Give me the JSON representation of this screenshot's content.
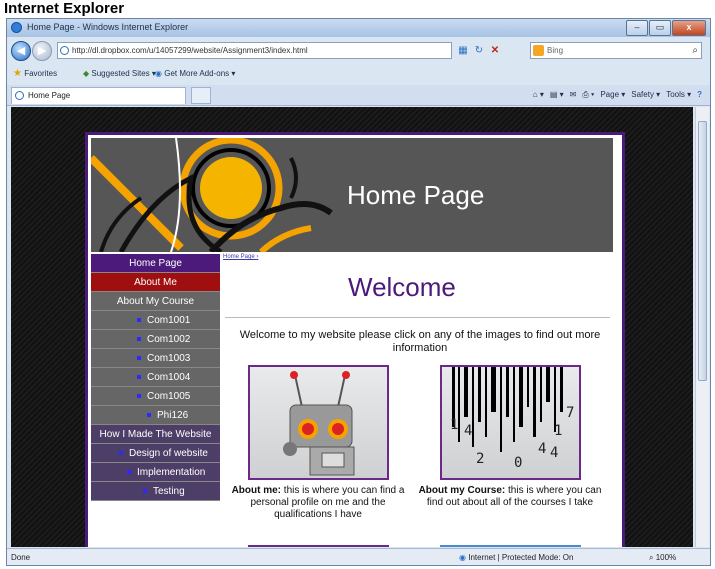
{
  "caption": "Internet Explorer",
  "window": {
    "title": "Home Page - Windows Internet Explorer",
    "controls": {
      "minimize": "–",
      "maximize": "▭",
      "close": "x"
    }
  },
  "address_bar": {
    "url": "http://dl.dropbox.com/u/14057299/website/Assignment3/index.html",
    "search_placeholder": "Bing"
  },
  "favorites_bar": {
    "favorites": "Favorites",
    "suggested": "Suggested Sites ▾",
    "addons": "Get More Add-ons ▾"
  },
  "tab": {
    "label": "Home Page"
  },
  "command_bar": {
    "page": "Page ▾",
    "safety": "Safety ▾",
    "tools": "Tools ▾",
    "help": "?"
  },
  "status_bar": {
    "done": "Done",
    "zone": "Internet | Protected Mode: On",
    "zoom": "100%"
  },
  "site": {
    "banner_title": "Home Page",
    "breadcrumb": "Home Page ›",
    "welcome": "Welcome",
    "intro": "Welcome to my website please click on any of the images to find out more information",
    "nav": {
      "home": "Home Page",
      "about": "About Me",
      "about_course": "About My Course",
      "courses": [
        "Com1001",
        "Com1002",
        "Com1003",
        "Com1004",
        "Com1005"
      ],
      "phi": "Phi126",
      "how": "How I Made The Website",
      "design": "Design of website",
      "implementation": "Implementation",
      "testing": "Testing"
    },
    "cards": [
      {
        "title": "About me:",
        "text": " this is where you can find a personal profile on me and the qualifications I have"
      },
      {
        "title": "About my Course:",
        "text": " this is where you can find out about all of the courses I take"
      }
    ],
    "barcode_digits": [
      "1",
      "4",
      "7",
      "1",
      "4",
      "4",
      "2",
      "0"
    ]
  },
  "colors": {
    "nav_home": "#4b1a7a",
    "nav_about": "#a00f0f",
    "nav_course": "#666666",
    "nav_how": "#4d3e67",
    "welcome": "#4b1a7a",
    "banner_bg": "#565656"
  }
}
